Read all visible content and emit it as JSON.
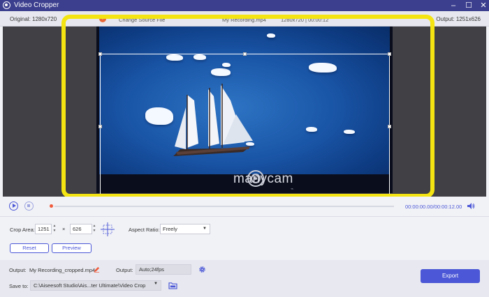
{
  "window": {
    "title": "Video Cropper",
    "minimize": "–",
    "maximize": "☐",
    "close": "✕"
  },
  "info": {
    "original": "Original: 1280x720",
    "warning_badge": "!",
    "change_source": "Change Source File",
    "file_name": "My Recording.mp4",
    "file_meta": "1280x720 | 00:00:12",
    "output": "Output: 1251x626"
  },
  "video": {
    "watermark": "manycam",
    "corner_icon": "link-icon"
  },
  "playback": {
    "current_time": "00:00:00.00",
    "total_time": "00:00:12.00",
    "time_display": "00:00:00.00/00:00:12.00",
    "progress": 0
  },
  "crop": {
    "area_label": "Crop Area:",
    "width": "1251",
    "times": "×",
    "height": "626",
    "aspect_label": "Aspect Ratio:",
    "aspect_value": "Freely",
    "reset_label": "Reset",
    "preview_label": "Preview"
  },
  "output": {
    "name_label": "Output:",
    "file_name": "My Recording_cropped.mp4",
    "settings_label": "Output:",
    "settings_value": "Auto;24fps",
    "save_label": "Save to:",
    "save_path": "C:\\Aiseesoft Studio\\Ais...ter Ultimate\\Video Crop",
    "export_label": "Export"
  },
  "colors": {
    "accent": "#4b57d6",
    "titlebar": "#3c3f8e",
    "highlight": "#f3e412",
    "seek_dot": "#f05a3c"
  }
}
